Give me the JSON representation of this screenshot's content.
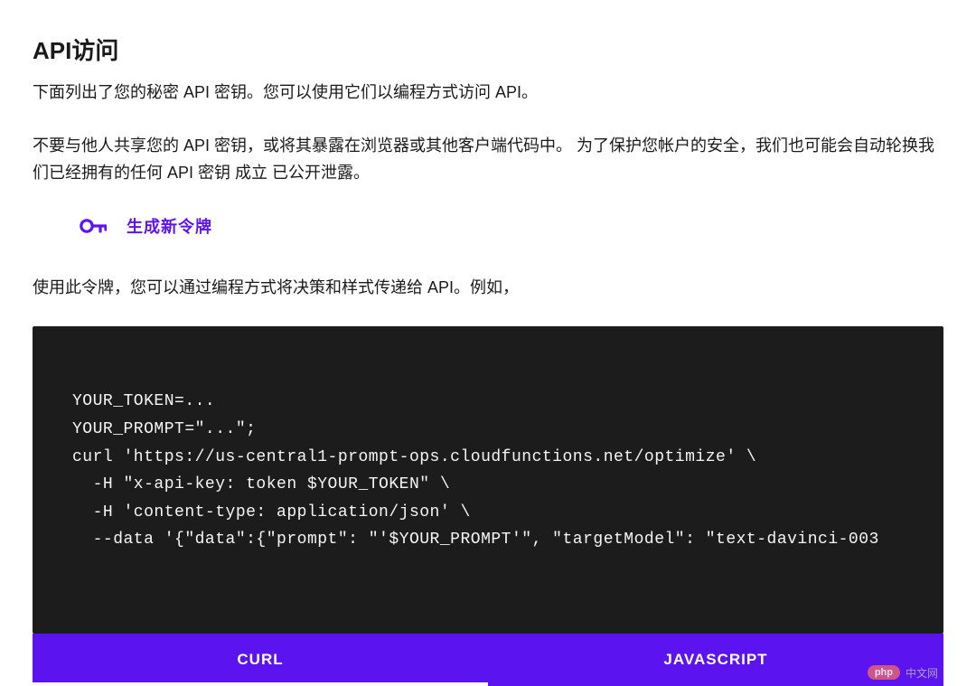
{
  "header": {
    "title": "API访问"
  },
  "paragraphs": {
    "p1": "下面列出了您的秘密 API 密钥。您可以使用它们以编程方式访问 API。",
    "p2": "不要与他人共享您的 API 密钥，或将其暴露在浏览器或其他客户端代码中。 为了保护您帐户的安全，我们也可能会自动轮换我们已经拥有的任何 API 密钥 成立 已公开泄露。",
    "usage": "使用此令牌，您可以通过编程方式将决策和样式传递给 API。例如，"
  },
  "generate": {
    "label": "生成新令牌"
  },
  "code": {
    "content": "YOUR_TOKEN=...\nYOUR_PROMPT=\"...\";\ncurl 'https://us-central1-prompt-ops.cloudfunctions.net/optimize' \\\n  -H \"x-api-key: token $YOUR_TOKEN\" \\\n  -H 'content-type: application/json' \\\n  --data '{\"data\":{\"prompt\": \"'$YOUR_PROMPT'\", \"targetModel\": \"text-davinci-003"
  },
  "tabs": {
    "curl": "CURL",
    "javascript": "JAVASCRIPT"
  },
  "watermark": {
    "badge": "php",
    "text": "中文网"
  },
  "colors": {
    "accent": "#5d14ef",
    "buttonBg": "#5b14f0",
    "codeBg": "#1c1c1c"
  }
}
